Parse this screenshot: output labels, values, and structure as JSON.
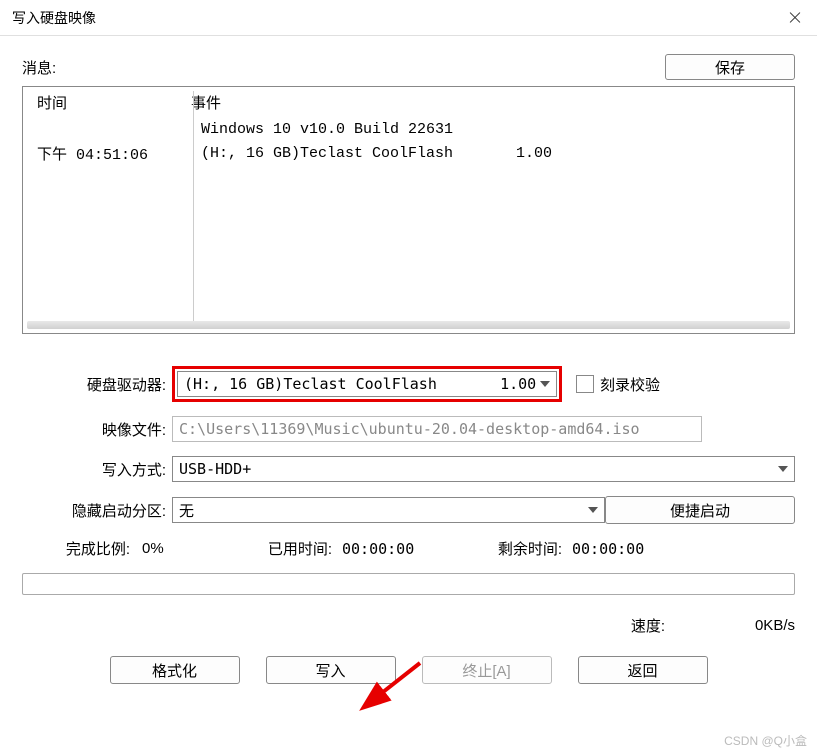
{
  "window": {
    "title": "写入硬盘映像"
  },
  "message": {
    "label": "消息:",
    "save_btn": "保存"
  },
  "log": {
    "header_time": "时间",
    "header_event": "事件",
    "rows": [
      {
        "time": "",
        "event": "Windows 10 v10.0 Build 22631"
      },
      {
        "time": "下午 04:51:06",
        "event": "(H:, 16 GB)Teclast CoolFlash       1.00"
      }
    ]
  },
  "form": {
    "drive_label": "硬盘驱动器:",
    "drive_value": "(H:, 16 GB)Teclast CoolFlash       1.00",
    "verify_label": "刻录校验",
    "image_label": "映像文件:",
    "image_value": "C:\\Users\\11369\\Music\\ubuntu-20.04-desktop-amd64.iso",
    "write_mode_label": "写入方式:",
    "write_mode_value": "USB-HDD+",
    "hide_boot_label": "隐藏启动分区:",
    "hide_boot_value": "无",
    "quick_boot_btn": "便捷启动"
  },
  "progress": {
    "percent_label": "完成比例:",
    "percent_value": "0%",
    "elapsed_label": "已用时间:",
    "elapsed_value": "00:00:00",
    "remaining_label": "剩余时间:",
    "remaining_value": "00:00:00"
  },
  "speed": {
    "label": "速度:",
    "value": "0KB/s"
  },
  "buttons": {
    "format": "格式化",
    "write": "写入",
    "abort": "终止[A]",
    "back": "返回"
  },
  "watermark": "CSDN @Q小盒"
}
